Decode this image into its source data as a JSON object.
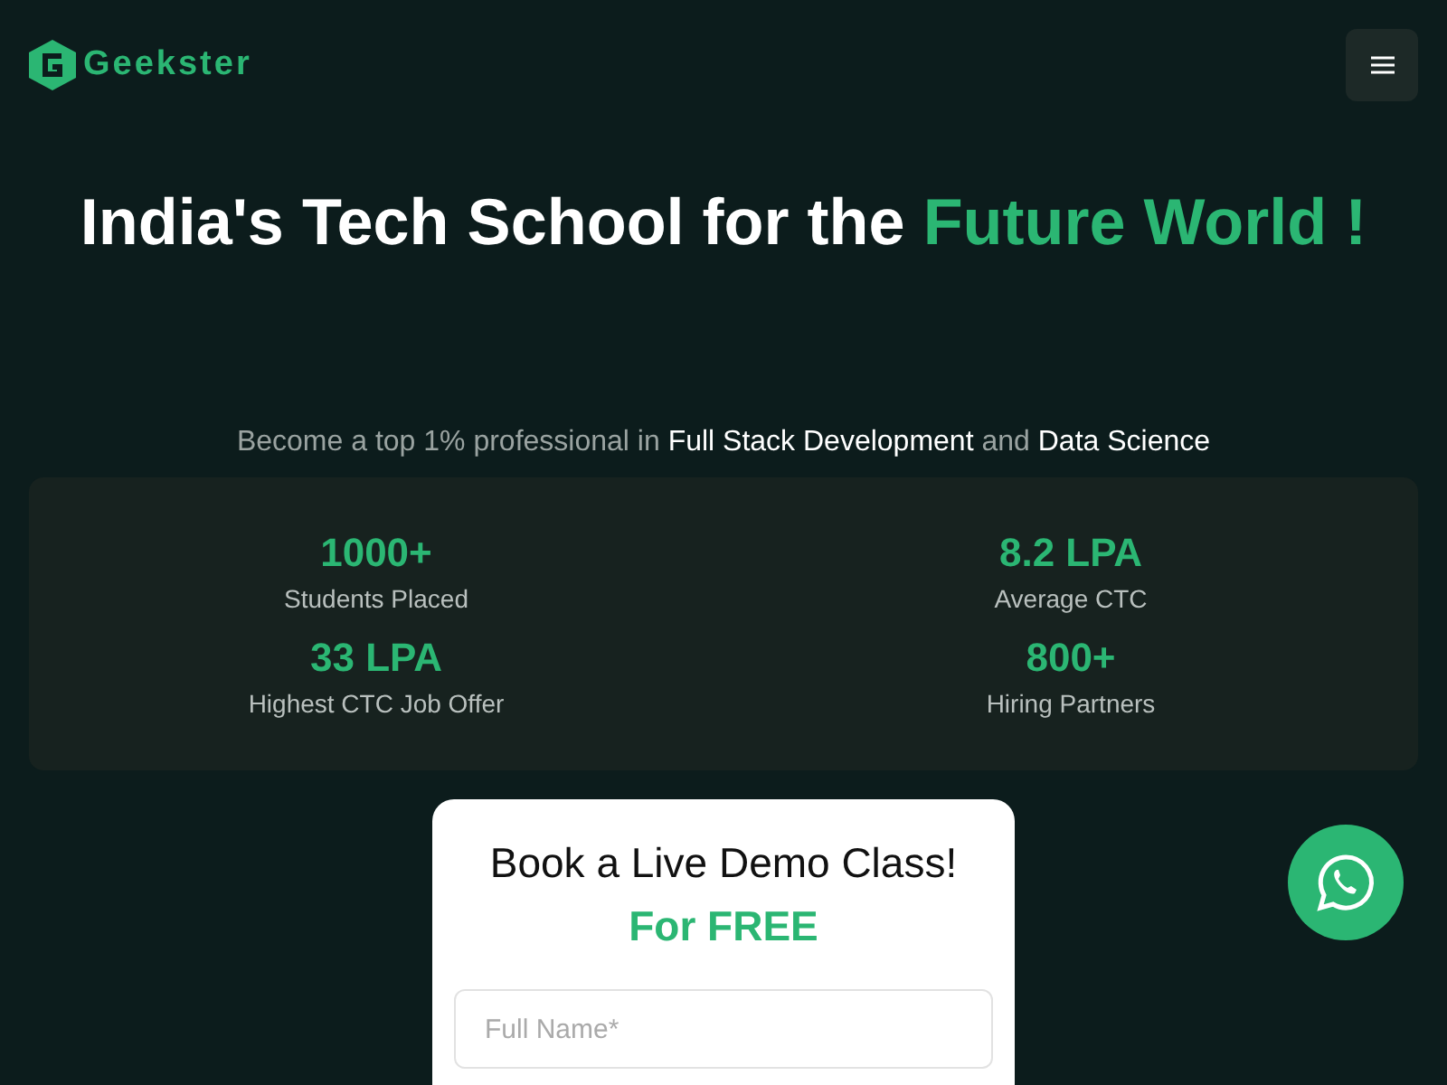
{
  "header": {
    "brand": "Geekster"
  },
  "hero": {
    "headline": [
      {
        "text": "India's Tech School for the ",
        "kind": "plain"
      },
      {
        "text": "Future World !",
        "kind": "accent"
      }
    ],
    "subtitle": [
      {
        "text": "Become a top 1% professional in ",
        "kind": "plain"
      },
      {
        "text": "Full Stack Development",
        "kind": "accent"
      },
      {
        "text": " and ",
        "kind": "plain"
      },
      {
        "text": "Data Science",
        "kind": "accent"
      }
    ]
  },
  "stats": [
    {
      "value": "1000+",
      "label": "Students Placed"
    },
    {
      "value": "8.2 LPA",
      "label": "Average CTC"
    },
    {
      "value": "33 LPA",
      "label": "Highest CTC Job Offer"
    },
    {
      "value": "800+",
      "label": "Hiring Partners"
    }
  ],
  "demo_form": {
    "title": "Book a Live Demo Class!",
    "subtitle": "For FREE",
    "fields": [
      {
        "placeholder": "Full Name*"
      }
    ]
  }
}
